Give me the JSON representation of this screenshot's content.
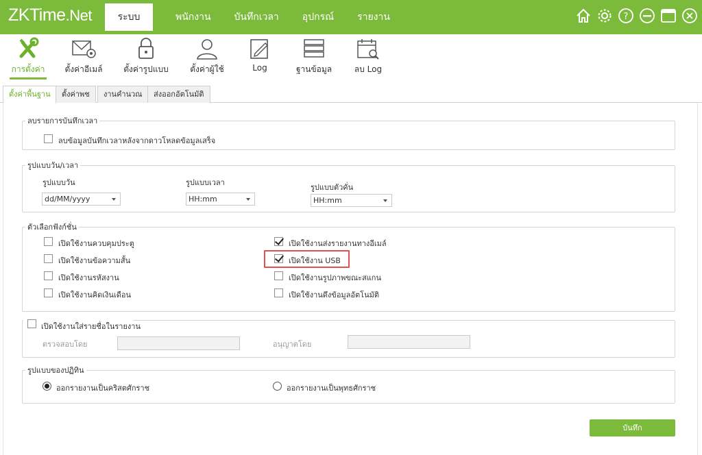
{
  "app": {
    "logo_main": "ZKTime",
    "logo_suffix": ".Net"
  },
  "nav": {
    "items": [
      "ระบบ",
      "พนักงาน",
      "บันทึกเวลา",
      "อุปกรณ์",
      "รายงาน"
    ]
  },
  "window_icons": [
    "home-icon",
    "settings-icon",
    "help-icon",
    "minimize-icon",
    "maximize-icon",
    "close-icon"
  ],
  "toolbar": {
    "items": [
      {
        "label": "การตั้งค่า",
        "icon": "tools-icon"
      },
      {
        "label": "ตั้งค่าอีเมล์",
        "icon": "email-settings-icon"
      },
      {
        "label": "ตั้งค่ารูปแบบ",
        "icon": "lock-icon"
      },
      {
        "label": "ตั้งค่าผู้ใช้",
        "icon": "user-icon"
      },
      {
        "label": "Log",
        "icon": "edit-log-icon"
      },
      {
        "label": "ฐานข้อมูล",
        "icon": "database-icon"
      },
      {
        "label": "ลบ Log",
        "icon": "delete-log-icon"
      }
    ]
  },
  "subtabs": [
    "ตั้งค่าพื้นฐาน",
    "ตั้งค่าพช",
    "งานคำนวณ",
    "ส่งออกอัตโนมัติ"
  ],
  "delete_records": {
    "legend": "ลบรายการบันทึกเวลา",
    "option": "ลบข้อมูลบันทึกเวลาหลังจากดาวโหลดข้อมูลเสร็จ",
    "checked": false
  },
  "format": {
    "legend": "รูปแบบวัน/เวลา",
    "date_label": "รูปแบบวัน",
    "date_value": "dd/MM/yyyy",
    "time_label": "รูปแบบเวลา",
    "time_value": "HH:mm",
    "sep_label": "รูปแบบตัวคั่น",
    "sep_value": "HH:mm"
  },
  "functions": {
    "legend": "ตัวเลือกฟังก์ชั่น",
    "left": [
      {
        "label": "เปิดใช้งานควบคุมประตู",
        "checked": false
      },
      {
        "label": "เปิดใช้งานข้อความสั้น",
        "checked": false
      },
      {
        "label": "เปิดใช้งานรหัสงาน",
        "checked": false
      },
      {
        "label": "เปิดใช้งานคิดเงินเดือน",
        "checked": false
      }
    ],
    "right": [
      {
        "label": "เปิดใช้งานส่งรายงานทางอีเมล์",
        "checked": true
      },
      {
        "label": "เปิดใช้งาน USB",
        "checked": true
      },
      {
        "label": "เปิดใช้งานรูปภาพขณะสแกน",
        "checked": false
      },
      {
        "label": "เปิดใช้งานดึงข้อมูลอัตโนมัติ",
        "checked": false
      }
    ]
  },
  "signature": {
    "legend": "เปิดใช้งานใส่รายชื่อในรายงาน",
    "checked": false,
    "checked_by_label": "ตรวจสอบโดย",
    "approved_by_label": "อนุญาตโดย",
    "checked_by_value": "",
    "approved_by_value": ""
  },
  "calendar": {
    "legend": "รูปแบบของปฏิทิน",
    "option_christian": "ออกรายงานเป็นคริสตศักราช",
    "option_buddhist": "ออกรายงานเป็นพุทธศักราช",
    "selected": "christian"
  },
  "save_label": "บันทึก",
  "colors": {
    "brand_green": "#7cba3c",
    "highlight_red": "#e05050"
  }
}
